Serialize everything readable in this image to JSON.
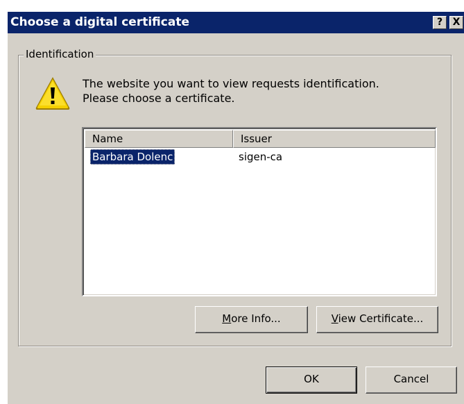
{
  "window": {
    "title": "Choose a digital certificate",
    "help_label": "?",
    "close_label": "X"
  },
  "identification": {
    "group_label": "Identification",
    "icon": "warning-triangle-icon",
    "message_line1": "The website you want to view requests identification.",
    "message_line2": "Please choose a certificate."
  },
  "certificates": {
    "columns": [
      "Name",
      "Issuer"
    ],
    "rows": [
      {
        "name": "Barbara Dolenc",
        "issuer": "sigen-ca",
        "selected": true
      }
    ]
  },
  "buttons": {
    "more_info": {
      "mnemonic": "M",
      "rest": "ore Info..."
    },
    "view_certificate": {
      "mnemonic": "V",
      "rest": "iew Certificate..."
    },
    "ok": "OK",
    "cancel": "Cancel"
  },
  "colors": {
    "titlebar": "#0a246a",
    "face": "#d4d0c8",
    "selection": "#0a246a",
    "warning": "#f5d000"
  }
}
